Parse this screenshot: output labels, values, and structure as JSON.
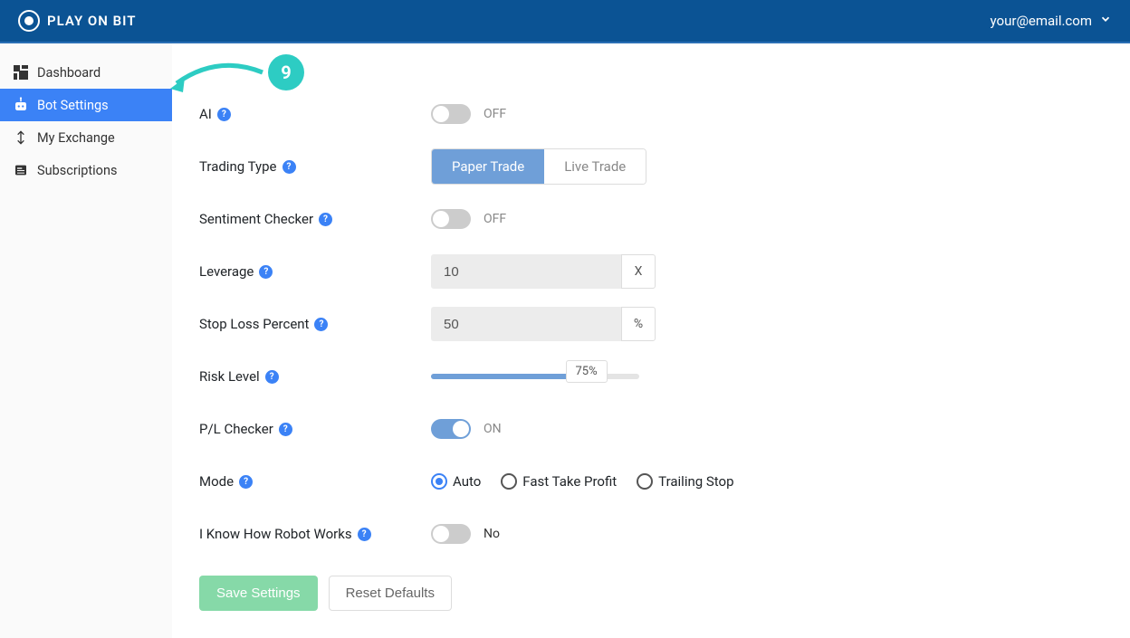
{
  "header": {
    "brand": "PLAY ON BIT",
    "user_email": "your@email.com"
  },
  "sidebar": {
    "items": [
      {
        "label": "Dashboard"
      },
      {
        "label": "Bot Settings"
      },
      {
        "label": "My Exchange"
      },
      {
        "label": "Subscriptions"
      }
    ]
  },
  "annotation": {
    "step_number": "9"
  },
  "form": {
    "ai": {
      "label": "AI",
      "state_label": "OFF"
    },
    "trading_type": {
      "label": "Trading Type",
      "option_paper": "Paper Trade",
      "option_live": "Live Trade"
    },
    "sentiment": {
      "label": "Sentiment Checker",
      "state_label": "OFF"
    },
    "leverage": {
      "label": "Leverage",
      "value": "10",
      "unit": "X"
    },
    "stop_loss": {
      "label": "Stop Loss Percent",
      "value": "50",
      "unit": "%"
    },
    "risk": {
      "label": "Risk Level",
      "percent_label": "75%"
    },
    "pl_checker": {
      "label": "P/L Checker",
      "state_label": "ON"
    },
    "mode": {
      "label": "Mode",
      "options": [
        "Auto",
        "Fast Take Profit",
        "Trailing Stop"
      ]
    },
    "ack": {
      "label": "I Know How Robot Works",
      "state_label": "No"
    },
    "save_label": "Save Settings",
    "reset_label": "Reset Defaults"
  }
}
